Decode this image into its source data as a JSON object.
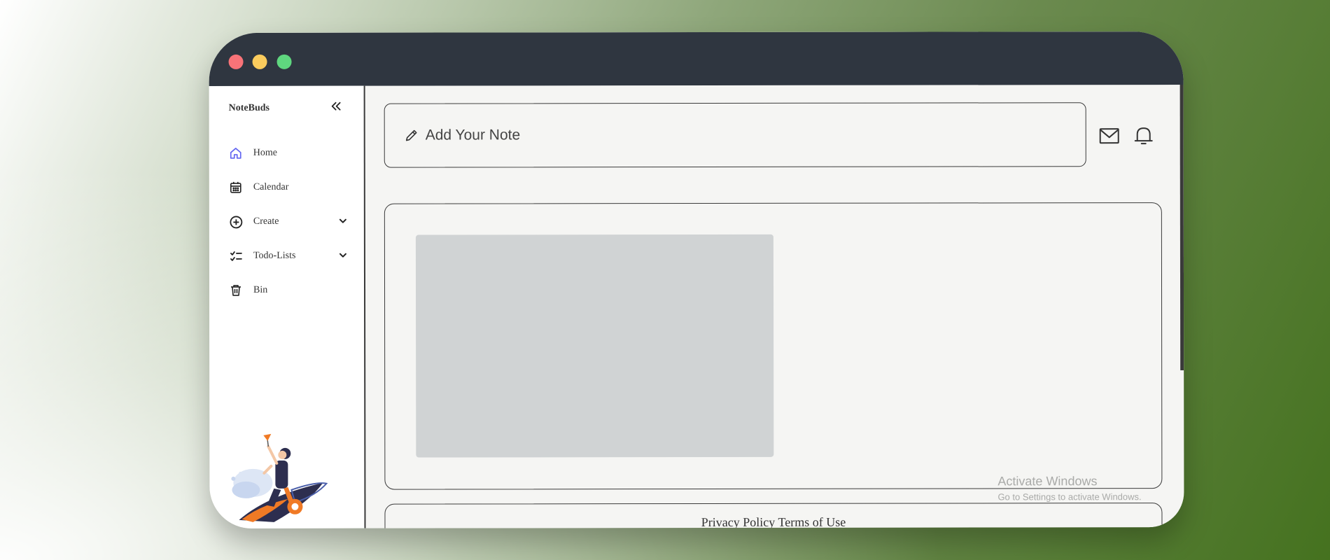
{
  "app": {
    "name": "NoteBuds"
  },
  "sidebar": {
    "items": [
      {
        "label": "Home",
        "icon": "home-icon",
        "active": true
      },
      {
        "label": "Calendar",
        "icon": "calendar-icon"
      },
      {
        "label": "Create",
        "icon": "plus-circle-icon",
        "expandable": true
      },
      {
        "label": "Todo-Lists",
        "icon": "checklist-icon",
        "expandable": true
      },
      {
        "label": "Bin",
        "icon": "trash-icon"
      }
    ]
  },
  "header": {
    "note_placeholder": "Add Your Note",
    "icons": [
      "mail-icon",
      "bell-icon"
    ]
  },
  "footer": {
    "privacy": "Privacy Policy",
    "terms": "Terms of Use"
  },
  "watermark": {
    "line1": "Activate Windows",
    "line2": "Go to Settings to activate Windows."
  },
  "colors": {
    "titlebar": "#2f3640",
    "accent": "#6366f1",
    "red": "#f87378",
    "yellow": "#fbcc5d",
    "green": "#5fd77f"
  }
}
